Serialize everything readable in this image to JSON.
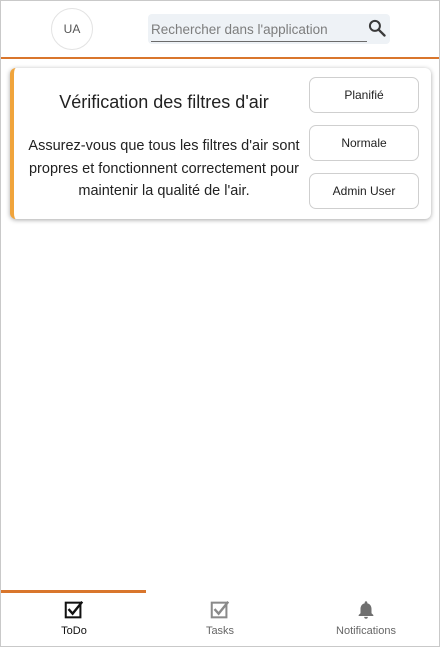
{
  "header": {
    "avatar_initials": "UA",
    "search": {
      "placeholder": "Rechercher dans l'application",
      "value": ""
    }
  },
  "task_card": {
    "title": "Vérification des filtres d'air",
    "description": "Assurez-vous que tous les filtres d'air sont propres et fonctionnent correctement pour maintenir la qualité de l'air.",
    "status_label": "Planifié",
    "priority_label": "Normale",
    "assignee_label": "Admin User"
  },
  "bottom_nav": {
    "items": [
      {
        "label": "ToDo",
        "icon": "checkbox-checked-icon",
        "active": true
      },
      {
        "label": "Tasks",
        "icon": "checkbox-checked-icon",
        "active": false
      },
      {
        "label": "Notifications",
        "icon": "bell-icon",
        "active": false
      }
    ]
  },
  "colors": {
    "accent": "#d9762c",
    "card_border": "#f0a43c",
    "search_bg": "#eef2f6",
    "inactive_icon": "#888888"
  }
}
